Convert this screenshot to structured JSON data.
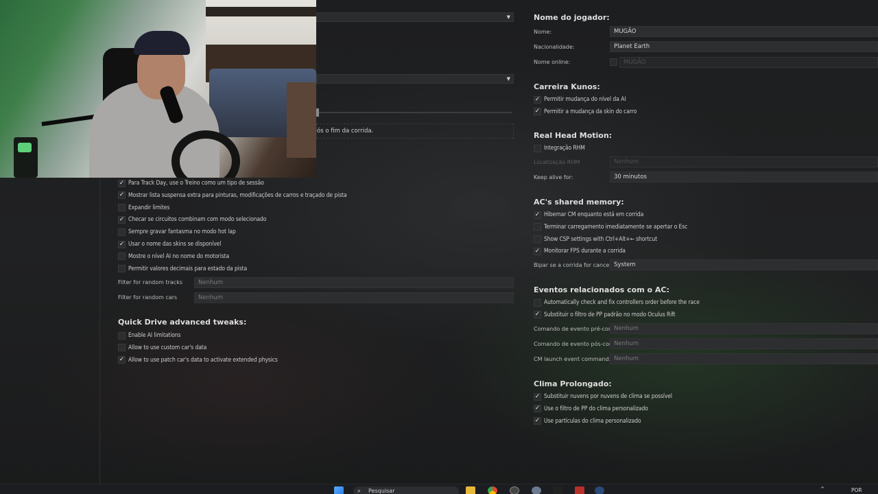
{
  "left_panel": {
    "partial_field_text": "ós o fim da corrida.",
    "checkboxes": [
      {
        "label": "Para Track Day, use o Treino como um tipo de sessão",
        "checked": true
      },
      {
        "label": "Mostrar lista suspensa extra para pinturas, modificações de carros e traçado de pista",
        "checked": true
      },
      {
        "label": "Expandir limites",
        "checked": false
      },
      {
        "label": "Checar se circuitos combinam com modo selecionado",
        "checked": true
      },
      {
        "label": "Sempre gravar fantasma no modo hot lap",
        "checked": false
      },
      {
        "label": "Usar o nome das skins se disponível",
        "checked": true
      },
      {
        "label": "Mostre o nível AI no nome do motorista",
        "checked": false
      },
      {
        "label": "Permitir valores decimais para estado da pista",
        "checked": false
      }
    ],
    "filter_tracks": {
      "label": "Filter for random tracks",
      "value": "Nenhum"
    },
    "filter_cars": {
      "label": "Filter for random cars",
      "value": "Nenhum"
    },
    "quick_drive": {
      "title": "Quick Drive advanced tweaks:",
      "checkboxes": [
        {
          "label": "Enable AI limitations",
          "checked": false
        },
        {
          "label": "Allow to use custom car's data",
          "checked": false
        },
        {
          "label": "Allow to use patch car's data to activate extended physics",
          "checked": true
        }
      ]
    }
  },
  "right_panel": {
    "player": {
      "title": "Nome do jogador:",
      "name_label": "Nome:",
      "name_value": "MUGÃO",
      "nationality_label": "Nacionalidade:",
      "nationality_value": "Planet Earth",
      "online_label": "Nome online:",
      "online_value": "MUGÃO"
    },
    "career": {
      "title": "Carreira Kunos:",
      "checkboxes": [
        {
          "label": "Permitir mudança do nível da AI",
          "checked": true
        },
        {
          "label": "Permitir a mudança da skin do carro",
          "checked": true
        }
      ]
    },
    "rhm": {
      "title": "Real Head Motion:",
      "checkbox": {
        "label": "Integração RHM",
        "checked": false
      },
      "location_label": "Localização RHM",
      "location_value": "Nenhum",
      "keep_alive_label": "Keep alive for:",
      "keep_alive_value": "30 minutos"
    },
    "shared_memory": {
      "title": "AC's shared memory:",
      "checkboxes": [
        {
          "label": "Hibernar CM enquanto está em corrida",
          "checked": true
        },
        {
          "label": "Terminar carregamento imediatamente se apertar o Esc",
          "checked": false
        },
        {
          "label": "Show CSP settings with Ctrl+Alt+← shortcut",
          "checked": false
        },
        {
          "label": "Monitorar FPS durante a corrida",
          "checked": true
        }
      ],
      "beep_label": "Bipar se a corrida for cancelad",
      "beep_value": "System"
    },
    "events": {
      "title": "Eventos relacionados com o AC:",
      "checkboxes": [
        {
          "label": "Automatically check and fix controllers order before the race",
          "checked": false
        },
        {
          "label": "Substituir o filtro de PP padrão no modo Oculus Rift",
          "checked": true
        }
      ],
      "pre_label": "Comando de evento pré-corrid",
      "pre_value": "Nenhum",
      "post_label": "Comando de evento pós-corrid",
      "post_value": "Nenhum",
      "launch_label": "CM launch event command:",
      "launch_value": "Nenhum"
    },
    "weather": {
      "title": "Clima Prolongado:",
      "checkboxes": [
        {
          "label": "Substituir nuvens por nuvens de clima se possível",
          "checked": true
        },
        {
          "label": "Use o filtro de PP do clima personalizado",
          "checked": true
        },
        {
          "label": "Use partículas do clima personalizado",
          "checked": true
        }
      ]
    }
  },
  "taskbar": {
    "search_placeholder": "Pesquisar",
    "lang": "POR"
  },
  "colors": {
    "background": "#1b1c1d",
    "field": "#2d2e30",
    "text": "#d4d4d4"
  }
}
